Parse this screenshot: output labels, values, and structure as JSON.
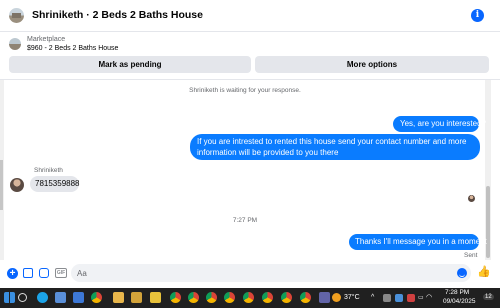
{
  "header": {
    "title": "Shriniketh · 2 Beds 2 Baths House",
    "info_glyph": "i"
  },
  "listing": {
    "category": "Marketplace",
    "title": "$960 - 2 Beds 2 Baths House",
    "mark_pending_label": "Mark as pending",
    "more_options_label": "More options"
  },
  "conversation": {
    "waiting_notice": "Shriniketh is waiting for your response.",
    "messages": [
      {
        "from": "me",
        "text": "Yes, are you interested?"
      },
      {
        "from": "me",
        "text": "If you are intrested to rented this house send your contact number and more information will be provided to you there"
      },
      {
        "from": "them",
        "sender": "Shriniketh",
        "text": "7815359888"
      },
      {
        "from": "me",
        "text": "Thanks I'll message you in a moment"
      }
    ],
    "timestamp": "7:27 PM",
    "status": "Sent"
  },
  "composer": {
    "placeholder": "Aa",
    "gif_label": "GIF"
  },
  "taskbar": {
    "temperature": "37°C",
    "time": "7:28 PM",
    "date": "09/04/2025",
    "notification_count": "12"
  },
  "colors": {
    "accent": "#0866ff",
    "bubble_out": "#0a7cff",
    "bubble_in": "#e4e6eb",
    "taskbar": "#202020"
  }
}
